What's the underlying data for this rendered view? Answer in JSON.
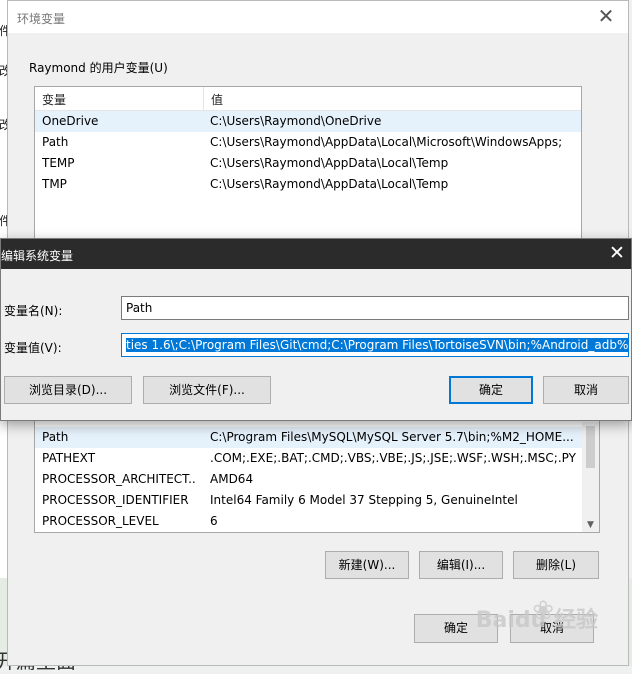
{
  "background": {
    "left_fragments": [
      "件",
      "改",
      "改",
      "件"
    ],
    "bottom_text": "开篇里面"
  },
  "env_dialog": {
    "title": "环境变量",
    "user_group_label": "Raymond 的用户变量(U)",
    "user_columns": [
      "变量",
      "值"
    ],
    "user_rows": [
      {
        "name": "OneDrive",
        "value": "C:\\Users\\Raymond\\OneDrive",
        "selected": true
      },
      {
        "name": "Path",
        "value": "C:\\Users\\Raymond\\AppData\\Local\\Microsoft\\WindowsApps;",
        "selected": false
      },
      {
        "name": "TEMP",
        "value": "C:\\Users\\Raymond\\AppData\\Local\\Temp",
        "selected": false
      },
      {
        "name": "TMP",
        "value": "C:\\Users\\Raymond\\AppData\\Local\\Temp",
        "selected": false
      }
    ],
    "system_rows": [
      {
        "name": "Path",
        "value": "C:\\Program Files\\MySQL\\MySQL Server 5.7\\bin;%M2_HOME...",
        "selected": true
      },
      {
        "name": "PATHEXT",
        "value": ".COM;.EXE;.BAT;.CMD;.VBS;.VBE;.JS;.JSE;.WSF;.WSH;.MSC;.PY",
        "selected": false
      },
      {
        "name": "PROCESSOR_ARCHITECT...",
        "value": "AMD64",
        "selected": false
      },
      {
        "name": "PROCESSOR_IDENTIFIER",
        "value": "Intel64 Family 6 Model 37 Stepping 5, GenuineIntel",
        "selected": false
      },
      {
        "name": "PROCESSOR_LEVEL",
        "value": "6",
        "selected": false
      }
    ],
    "system_buttons": {
      "new": "新建(W)...",
      "edit": "编辑(I)...",
      "delete": "删除(L)"
    },
    "ok": "确定",
    "cancel": "取消"
  },
  "edit_dialog": {
    "title": "编辑系统变量",
    "name_label": "变量名(N):",
    "name_value": "Path",
    "value_label": "变量值(V):",
    "value_text": "ties 1.6\\;C:\\Program Files\\Git\\cmd;C:\\Program Files\\TortoiseSVN\\bin;%Android_adb%;",
    "browse_dir": "浏览目录(D)...",
    "browse_file": "浏览文件(F)...",
    "ok": "确定",
    "cancel": "取消"
  },
  "watermark": {
    "text": "Baidu 经验"
  },
  "colors": {
    "accent": "#0078d7",
    "selection": "#e5f1fb",
    "edit_titlebar": "#2b2b2b"
  }
}
